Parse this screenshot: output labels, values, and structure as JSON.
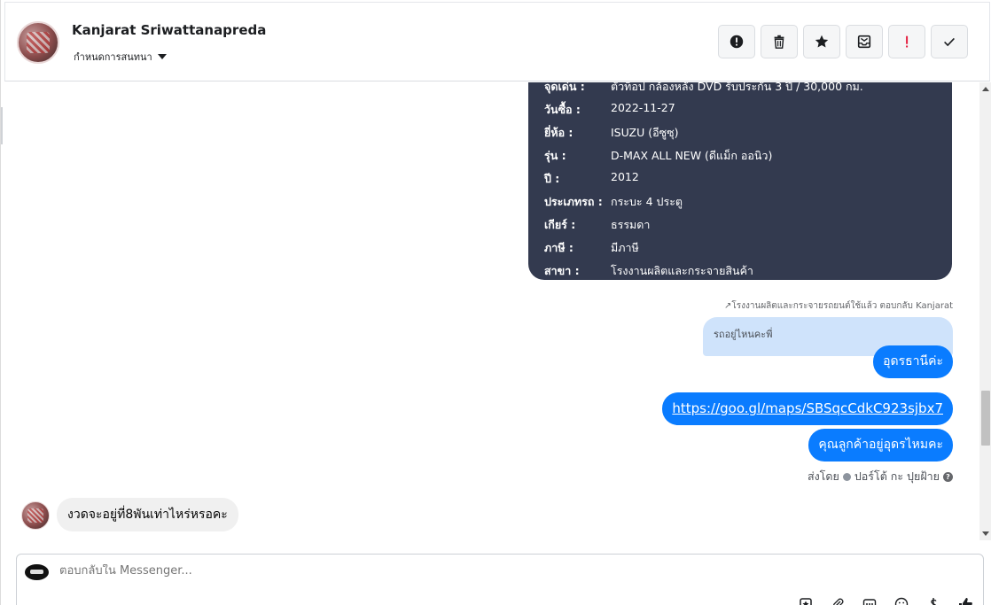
{
  "header": {
    "contact_name": "Kanjarat Sriwattanapreda",
    "conversation_label": "กำหนดการสนทนา",
    "toolbar_icons": [
      "report-icon",
      "trash-icon",
      "star-icon",
      "inbox-icon",
      "important-icon",
      "check-icon"
    ]
  },
  "card": {
    "rows": [
      {
        "key": "จุดเด่น :",
        "value": "ตัวท็อป กล้องหลัง DVD รับประกัน 3 ปี / 30,000 กม."
      },
      {
        "key": "วันซื้อ :",
        "value": "2022-11-27"
      },
      {
        "key": "ยี่ห้อ :",
        "value": "ISUZU (อีซูซุ)"
      },
      {
        "key": "รุ่น :",
        "value": "D-MAX ALL NEW (ดีแม็ก ออนิว)"
      },
      {
        "key": "ปี :",
        "value": "2012"
      },
      {
        "key": "ประเภทรถ :",
        "value": "กระบะ 4 ประตู"
      },
      {
        "key": "เกียร์ :",
        "value": "ธรรมดา"
      },
      {
        "key": "ภาษี :",
        "value": "มีภาษี"
      },
      {
        "key": "สาขา :",
        "value": "โรงงานผลิตและกระจายสินค้า"
      }
    ]
  },
  "messages": {
    "reply_meta": "โรงงานผลิตและกระจายรถยนต์ใช้แล้ว ตอบกลับ Kanjarat",
    "quoted_text": "รถอยู่ไหนคะพี่",
    "out_1": "อุดรธานีค่ะ",
    "out_2_link": "https://goo.gl/maps/SBSqcCdkC923sjbx7",
    "out_3": "คุณลูกค้าอยู่อุดรไหมคะ",
    "sent_by_prefix": "ส่งโดย",
    "sent_by_name": "ปอร์โต้ กะ ปุยฝ้าย",
    "incoming_1": "งวดจะอยู่ที่8พันเท่าไหร่หรอคะ"
  },
  "composer": {
    "placeholder": "ตอบกลับใน Messenger..."
  },
  "colors": {
    "outgoing_bubble": "#0a7cff",
    "card_bg": "#333a4f",
    "quoted_bg": "#cfe3fb",
    "incoming_bubble": "#f0f0f0"
  }
}
